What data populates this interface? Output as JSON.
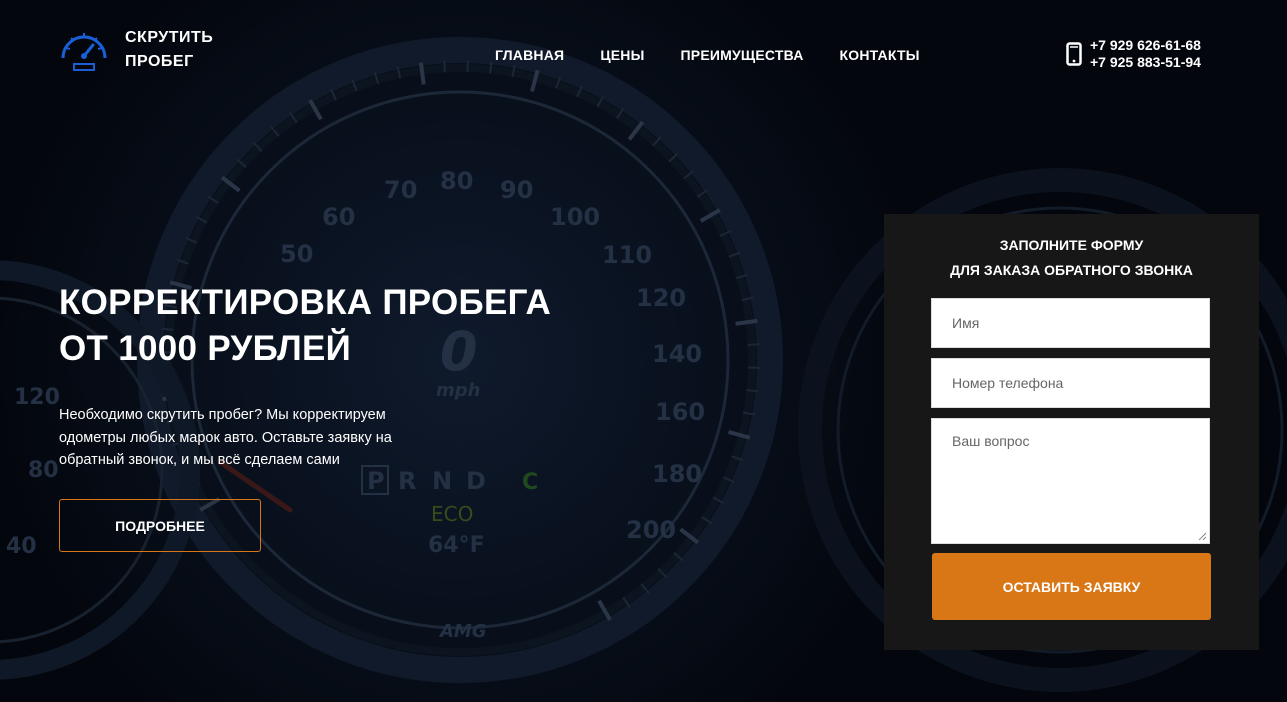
{
  "brand": {
    "line1": "СКРУТИТЬ",
    "line2": "ПРОБЕГ",
    "icon": "speedometer-icon"
  },
  "nav": {
    "items": [
      {
        "label": "ГЛАВНАЯ"
      },
      {
        "label": "ЦЕНЫ"
      },
      {
        "label": "ПРЕИМУЩЕСТВА"
      },
      {
        "label": "КОНТАКТЫ"
      }
    ]
  },
  "contacts": {
    "icon": "mobile-phone-icon",
    "phones": [
      "+7 929 626-61-68",
      "+7 925 883-51-94"
    ]
  },
  "hero": {
    "title_line1": "КОРРЕКТИРОВКА ПРОБЕГА",
    "title_line2": "ОТ 1000 РУБЛЕЙ",
    "description": "Необходимо скрутить пробег? Мы корректируем одометры любых марок авто. Оставьте заявку на обратный звонок, и мы всё сделаем сами",
    "more_button": "ПОДРОБНЕЕ"
  },
  "background": {
    "dial_numbers": [
      "50",
      "60",
      "70",
      "80",
      "90",
      "100",
      "110",
      "120",
      "140",
      "160",
      "180",
      "200"
    ],
    "center_value": "0",
    "center_unit": "mph",
    "gear_letters": [
      "P",
      "R",
      "N",
      "D"
    ],
    "gear_c": "C",
    "eco": "ECO",
    "temperature": "64°F",
    "badge": "AMG",
    "left_dial_numbers": [
      "120",
      "80",
      "40"
    ]
  },
  "form": {
    "title_line1": "ЗАПОЛНИТЕ ФОРМУ",
    "title_line2": "ДЛЯ ЗАКАЗА ОБРАТНОГО ЗВОНКА",
    "name_placeholder": "Имя",
    "phone_placeholder": "Номер телефона",
    "question_placeholder": "Ваш вопрос",
    "submit_label": "ОСТАВИТЬ ЗАЯВКУ"
  },
  "colors": {
    "accent": "#d97716",
    "logo_blue": "#1a5fd6",
    "background": "#03060d",
    "form_bg": "#171717"
  }
}
